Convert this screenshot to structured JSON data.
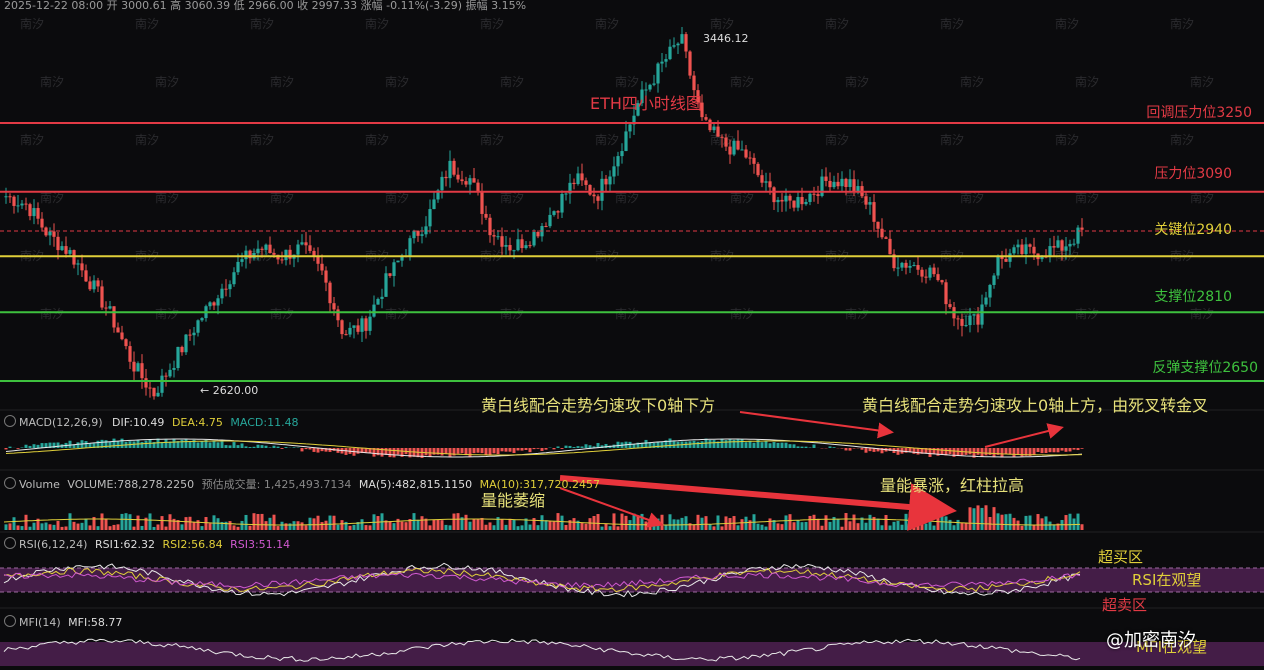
{
  "header": {
    "date": "2025-12-22 08:00",
    "open_label": "开",
    "open": "3000.61",
    "high_label": "高",
    "high": "3060.39",
    "low_label": "低",
    "low": "2966.00",
    "close_label": "收",
    "close": "2997.33",
    "change_label": "涨幅",
    "change": "-0.11%(-3.29)",
    "amp_label": "振幅",
    "amp": "3.15%"
  },
  "chart_title": "ETH四小时线图",
  "levels": [
    {
      "label": "回调压力位3250",
      "price": 3250,
      "color": "#e23a45"
    },
    {
      "label": "压力位3090",
      "price": 3090,
      "color": "#e23a45"
    },
    {
      "label": "关键位2940",
      "price": 2940,
      "color": "#e0cf3a"
    },
    {
      "label": "支撑位2810",
      "price": 2810,
      "color": "#3ec13e"
    },
    {
      "label": "反弹支撑位2650",
      "price": 2650,
      "color": "#3ec13e"
    }
  ],
  "price_marks": {
    "high": "3446.12",
    "low": "← 2620.00"
  },
  "macd": {
    "label": "MACD(12,26,9)",
    "dif": "DIF:10.49",
    "dea": "DEA:4.75",
    "macd": "MACD:11.48"
  },
  "volume": {
    "label": "Volume",
    "volume": "VOLUME:788,278.2250",
    "forecast": "预估成交量: 1,425,493.7134",
    "ma5": "MA(5):482,815.1150",
    "ma10": "MA(10):317,720.2457"
  },
  "rsi": {
    "label": "RSI(6,12,24)",
    "rsi1": "RSI1:62.32",
    "rsi2": "RSI2:56.84",
    "rsi3": "RSI3:51.14"
  },
  "mfi": {
    "label": "MFI(14)",
    "value": "MFI:58.77"
  },
  "annotations": {
    "macd_left": "黄白线配合走势匀速攻下0轴下方",
    "macd_right": "黄白线配合走势匀速攻上0轴上方，由死叉转金叉",
    "vol_right": "量能暴涨，红柱拉高",
    "vol_left": "量能萎缩",
    "overbought": "超买区",
    "rsi_watch": "RSI在观望",
    "oversold": "超卖区",
    "mfi_watch": "MFI在观望"
  },
  "watermark": "南汐",
  "brand": "@加密南汐",
  "colors": {
    "up": "#26a69a",
    "down": "#ef5350",
    "red": "#e23a45",
    "yellow": "#e0cf3a",
    "green": "#3ec13e"
  },
  "chart_data": {
    "type": "candlestick",
    "symbol_title": "ETH四小时线图",
    "price_range": [
      2600,
      3480
    ],
    "horizontal_levels": [
      3250,
      3090,
      2940,
      2810,
      2650
    ],
    "close_path": [
      3080,
      3060,
      2990,
      2950,
      2880,
      2800,
      2690,
      2620,
      2700,
      2780,
      2850,
      2920,
      2960,
      2940,
      2960,
      2900,
      2760,
      2780,
      2880,
      2960,
      3030,
      3150,
      3120,
      3000,
      2960,
      2990,
      3050,
      3120,
      3080,
      3180,
      3300,
      3380,
      3446,
      3250,
      3200,
      3180,
      3100,
      3060,
      3080,
      3120,
      3110,
      3050,
      2930,
      2920,
      2900,
      2800,
      2790,
      2930,
      2950,
      2950,
      2960,
      2997
    ]
  }
}
